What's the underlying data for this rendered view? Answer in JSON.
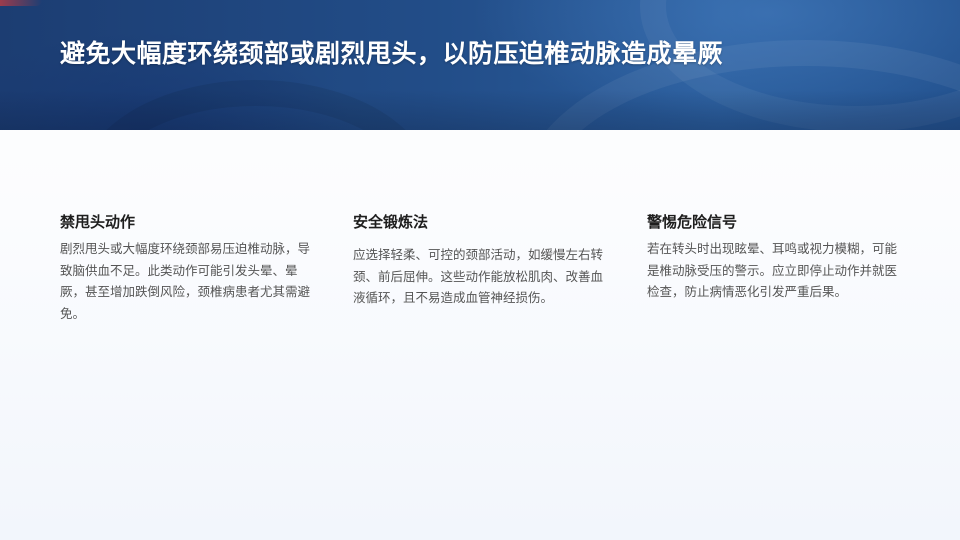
{
  "header": {
    "title": "避免大幅度环绕颈部或剧烈甩头，以防压迫椎动脉造成晕厥"
  },
  "columns": [
    {
      "heading": "禁甩头动作",
      "body": "剧烈甩头或大幅度环绕颈部易压迫椎动脉，导致脑供血不足。此类动作可能引发头晕、晕厥，甚至增加跌倒风险，颈椎病患者尤其需避免。"
    },
    {
      "heading": "安全锻炼法",
      "body": "应选择轻柔、可控的颈部活动，如缓慢左右转颈、前后屈伸。这些动作能放松肌肉、改善血液循环，且不易造成血管神经损伤。"
    },
    {
      "heading": "警惕危险信号",
      "body": "若在转头时出现眩晕、耳鸣或视力模糊，可能是椎动脉受压的警示。应立即停止动作并就医检查，防止病情恶化引发严重后果。"
    }
  ],
  "colors": {
    "banner": "#224d88",
    "title_text": "#ffffff",
    "heading_text": "#1e1e1e",
    "body_text": "#555555"
  }
}
